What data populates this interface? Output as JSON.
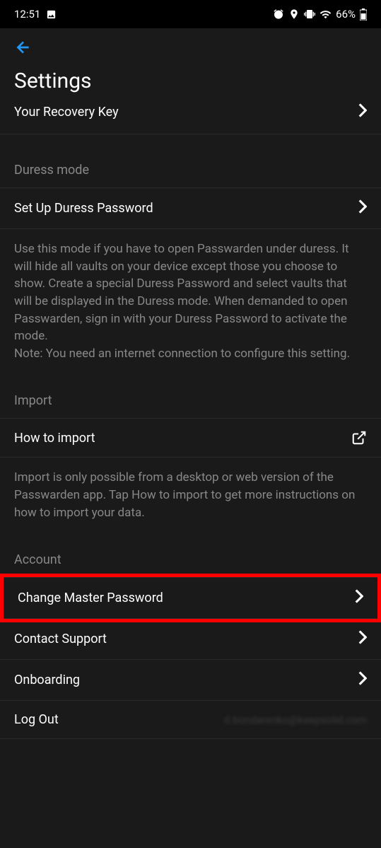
{
  "statusBar": {
    "time": "12:51",
    "battery": "66%"
  },
  "header": {
    "title": "Settings"
  },
  "recoveryKey": {
    "label": "Your Recovery Key"
  },
  "duress": {
    "header": "Duress mode",
    "setup": "Set Up Duress Password",
    "description": "Use this mode if you have to open Passwarden under duress. It will hide all vaults on your device except those you choose to show. Create a special Duress Password and select vaults that will be displayed in the Duress mode. When demanded to open Passwarden, sign in with your Duress Password to activate the mode.\nNote: You need an internet connection to configure this setting."
  },
  "import": {
    "header": "Import",
    "howTo": "How to import",
    "description": "Import is only possible from a desktop or web version of the Passwarden app. Tap How to import to get more instructions on how to import your data."
  },
  "account": {
    "header": "Account",
    "changeMaster": "Change Master Password",
    "contactSupport": "Contact Support",
    "onboarding": "Onboarding",
    "logOut": "Log Out",
    "emailBlurred": "d.bondarenko@keepsolid.com"
  }
}
